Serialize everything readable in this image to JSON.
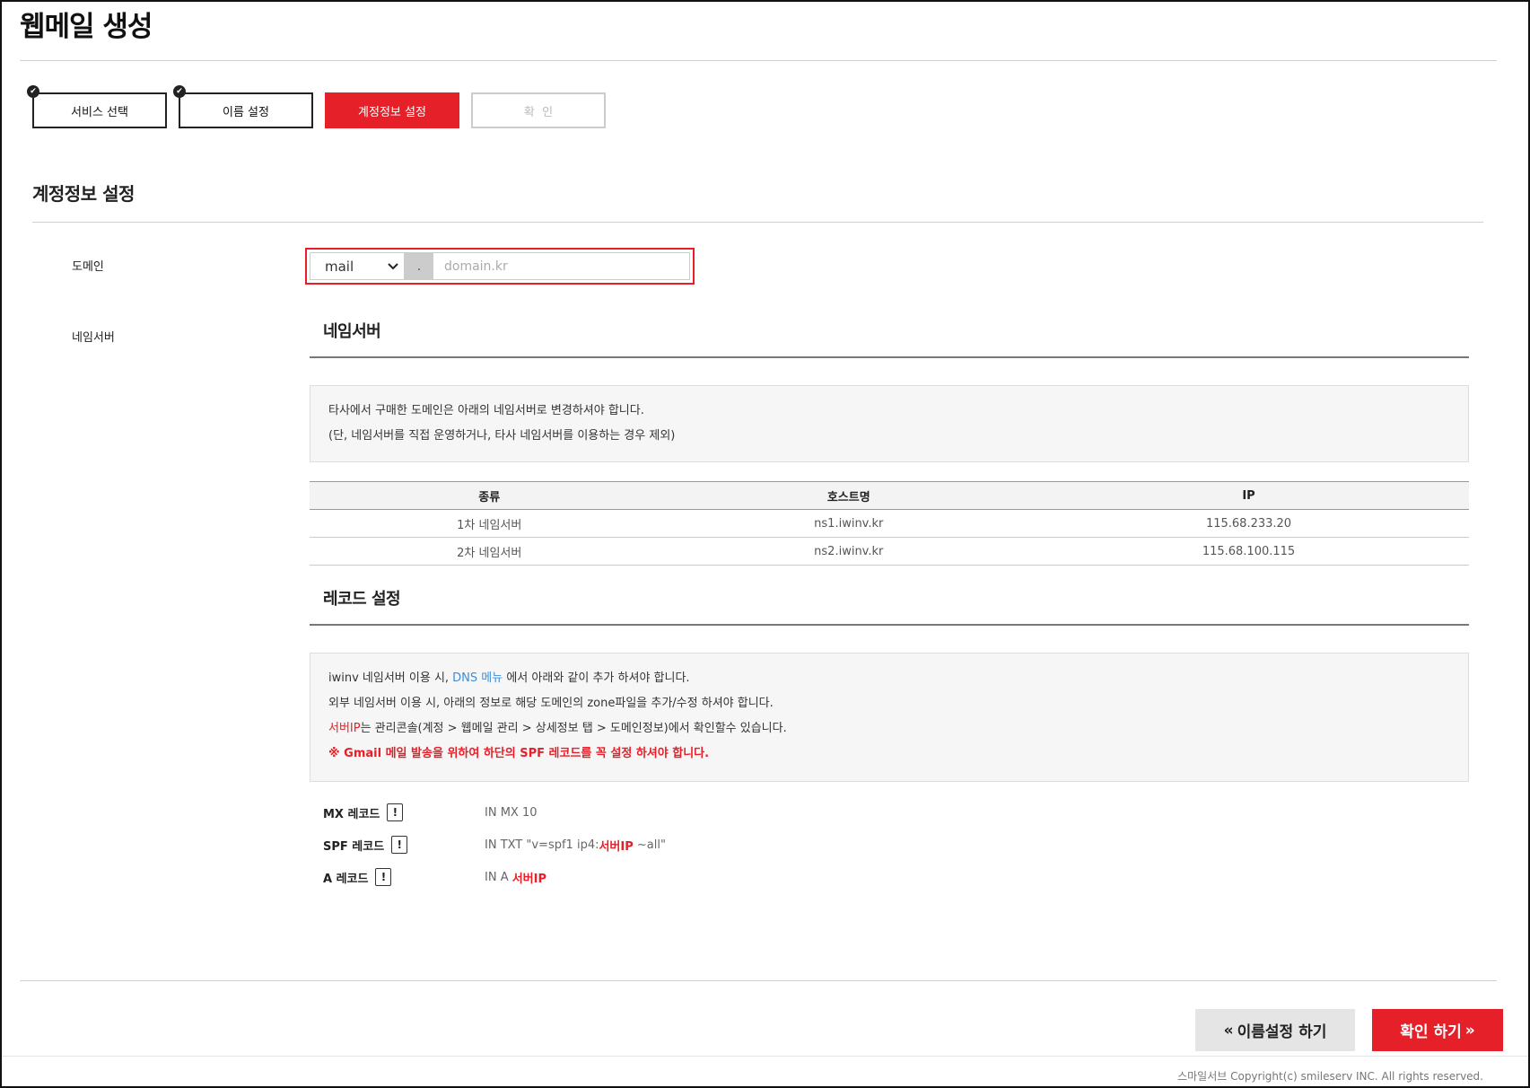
{
  "page_title": "웹메일 생성",
  "steps": [
    {
      "label": "서비스 선택",
      "state": "done"
    },
    {
      "label": "이름 설정",
      "state": "done"
    },
    {
      "label": "계정정보 설정",
      "state": "active"
    },
    {
      "label": "확  인",
      "state": "disabled"
    }
  ],
  "section_title": "계정정보 설정",
  "domain": {
    "label": "도메인",
    "prefix_selected": "mail",
    "separator": ".",
    "placeholder": "domain.kr",
    "value": ""
  },
  "nameserver": {
    "label": "네임서버",
    "title": "네임서버",
    "info_lines": [
      "타사에서 구매한 도메인은 아래의 네임서버로 변경하셔야 합니다.",
      "(단, 네임서버를 직접 운영하거나, 타사 네임서버를 이용하는 경우 제외)"
    ],
    "table": {
      "headers": [
        "종류",
        "호스트명",
        "IP"
      ],
      "rows": [
        [
          "1차 네임서버",
          "ns1.iwinv.kr",
          "115.68.233.20"
        ],
        [
          "2차 네임서버",
          "ns2.iwinv.kr",
          "115.68.100.115"
        ]
      ]
    }
  },
  "record": {
    "title": "레코드 설정",
    "info": {
      "line1_pre": "iwinv 네임서버 이용 시, ",
      "line1_link": "DNS 메뉴",
      "line1_post": " 에서 아래와 같이 추가 하셔야 합니다.",
      "line2": "외부 네임서버 이용 시, 아래의 정보로 해당 도메인의 zone파일을 추가/수정 하셔야 합니다.",
      "line3_red": "서버IP",
      "line3_post": "는 관리콘솔(계정 > 웹메일 관리 > 상세정보 탭 > 도메인정보)에서 확인할수 있습니다.",
      "line4": "※ Gmail 메일 발송을 위하여 하단의 SPF 레코드를 꼭 설정 하셔야 합니다."
    },
    "items": [
      {
        "label": "MX 레코드",
        "value_pre": "IN MX 10",
        "value_red": "",
        "value_post": ""
      },
      {
        "label": "SPF 레코드",
        "value_pre": "IN TXT \"v=spf1 ip4:",
        "value_red": "서버IP",
        "value_post": " ~all\""
      },
      {
        "label": "A 레코드",
        "value_pre": "IN A ",
        "value_red": "서버IP",
        "value_post": ""
      }
    ],
    "info_icon": "exclamation-icon"
  },
  "buttons": {
    "prev_label": "이름설정 하기",
    "next_label": "확인 하기",
    "prev_icon": "«",
    "next_icon": "»"
  },
  "footer": {
    "copyright": "스마일서브 Copyright(c) smileserv INC. All rights reserved."
  },
  "colors": {
    "accent": "#e52028",
    "link": "#3d8ed8"
  }
}
